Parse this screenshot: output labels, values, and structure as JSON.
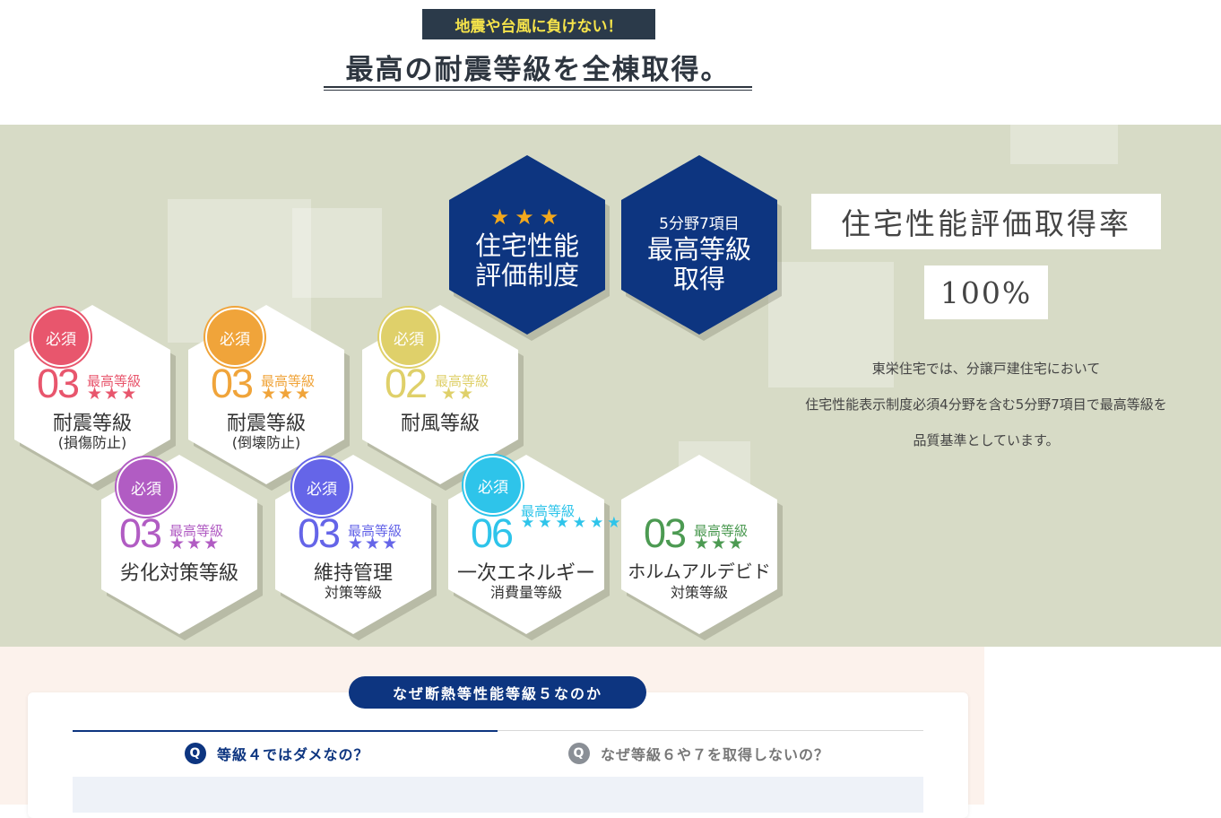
{
  "header": {
    "tagline": "地震や台風に負けない！",
    "headline": "最高の耐震等級を全棟取得。"
  },
  "navy_hexes": [
    {
      "stars": "★★★",
      "line1": "住宅性能",
      "line2": "評価制度"
    },
    {
      "small": "5分野7項目",
      "line1": "最高等級",
      "line2": "取得"
    }
  ],
  "grade_hexes": [
    {
      "badge": "必須",
      "number": "03",
      "grade_label": "最高等級",
      "stars": "★★★",
      "title": "耐震等級",
      "sub": "(損傷防止)",
      "color": "#e8566d"
    },
    {
      "badge": "必須",
      "number": "03",
      "grade_label": "最高等級",
      "stars": "★★★",
      "title": "耐震等級",
      "sub": "(倒壊防止)",
      "color": "#f0a43a"
    },
    {
      "badge": "必須",
      "number": "02",
      "grade_label": "最高等級",
      "stars": "★★",
      "title": "耐風等級",
      "sub": "",
      "color": "#dfd06a"
    },
    {
      "badge": "必須",
      "number": "03",
      "grade_label": "最高等級",
      "stars": "★★★",
      "title": "劣化対策等級",
      "sub": "",
      "color": "#b15cc3"
    },
    {
      "badge": "必須",
      "number": "03",
      "grade_label": "最高等級",
      "stars": "★★★",
      "title": "維持管理",
      "sub": "対策等級",
      "color": "#6565e8"
    },
    {
      "badge": "必須",
      "number": "06",
      "grade_label": "最高等級",
      "stars": "★★★★★★",
      "title": "一次エネルギー",
      "sub": "消費量等級",
      "color": "#2ec4ea"
    },
    {
      "badge": "",
      "number": "03",
      "grade_label": "最高等級",
      "stars": "★★★",
      "title": "ホルムアルデビド",
      "sub": "対策等級",
      "color": "#4c9a52"
    }
  ],
  "rate": {
    "title": "住宅性能評価取得率",
    "value": "100%",
    "desc_line1": "東栄住宅では、分譲戸建住宅において",
    "desc_line2": "住宅性能表示制度必須4分野を含む5分野7項目で最高等級を",
    "desc_line3": "品質基準としています。"
  },
  "faq": {
    "pill": "なぜ断熱等性能等級５なのか",
    "tab1": "等級４ではダメなの？",
    "tab2": "なぜ等級６や７を取得しないの？",
    "q_icon": "Q"
  },
  "colors": {
    "navy": "#0d3580",
    "band": "#d7dbc6",
    "star": "#f2a81d"
  }
}
